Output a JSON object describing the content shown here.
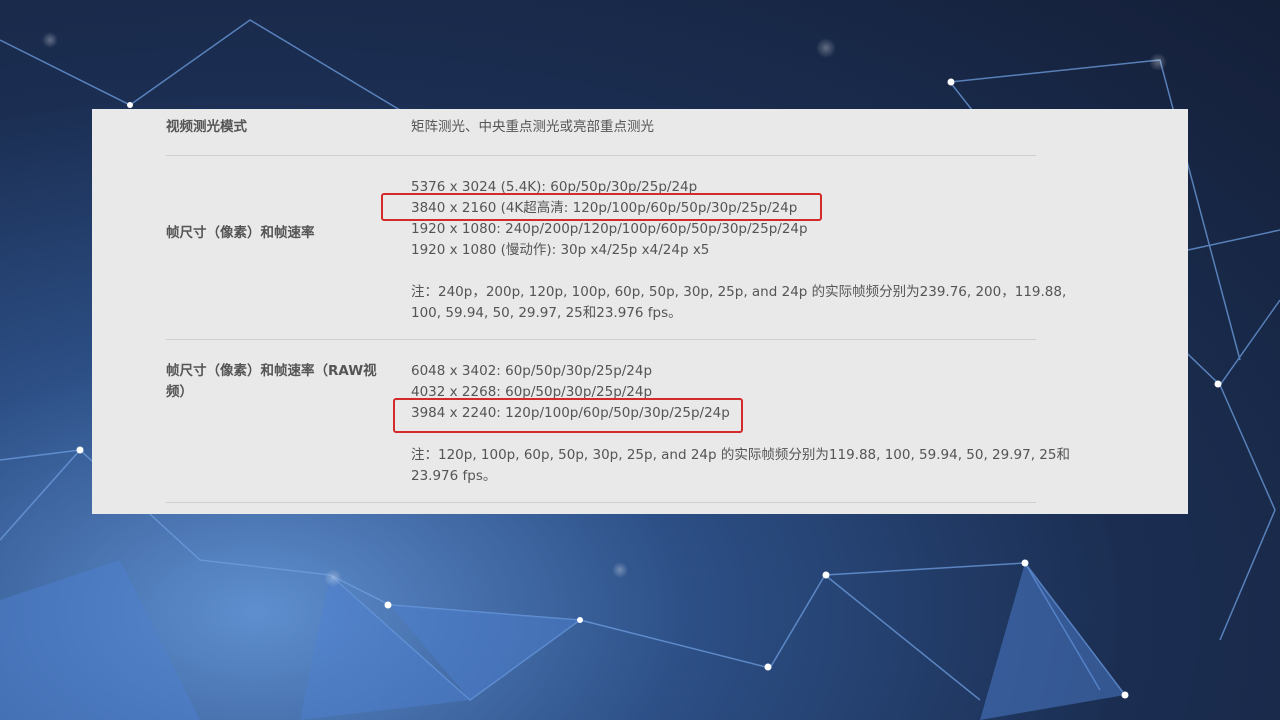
{
  "specs": [
    {
      "label": "视频测光模式",
      "values": [
        "矩阵测光、中央重点测光或亮部重点测光"
      ]
    },
    {
      "label": "帧尺寸（像素）和帧速率",
      "values": [
        "5376 x 3024 (5.4K): 60p/50p/30p/25p/24p",
        "3840 x 2160 (4K超高清: 120p/100p/60p/50p/30p/25p/24p",
        "1920 x 1080: 240p/200p/120p/100p/60p/50p/30p/25p/24p",
        "1920 x 1080 (慢动作): 30p x4/25p x4/24p x5"
      ],
      "note": [
        "注：240p，200p, 120p, 100p, 60p, 50p, 30p, 25p, and 24p 的实际帧频分别为239.76, 200，119.88,",
        "100, 59.94, 50, 29.97, 25和23.976 fps。"
      ]
    },
    {
      "label": [
        "帧尺寸（像素）和帧速率（RAW视",
        "频）"
      ],
      "values": [
        "6048 x 3402: 60p/50p/30p/25p/24p",
        "4032 x 2268: 60p/50p/30p/25p/24p",
        "3984 x 2240: 120p/100p/60p/50p/30p/25p/24p"
      ],
      "note": [
        "注：120p, 100p, 60p, 50p, 30p, 25p, and 24p 的实际帧频分别为119.88, 100, 59.94, 50, 29.97, 25和",
        "23.976 fps。"
      ]
    }
  ],
  "highlight_color": "#d32a2a",
  "background": {
    "style": "blue polygon network"
  }
}
